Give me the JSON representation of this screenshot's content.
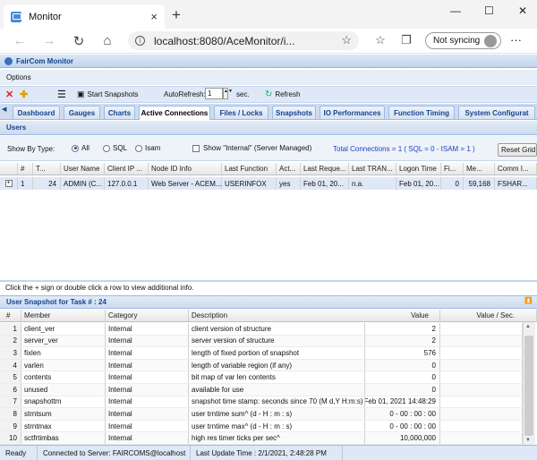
{
  "browser": {
    "tab_title": "Monitor",
    "new_tab": "+",
    "tab_close": "×",
    "address": "localhost:8080/AceMonitor/i...",
    "sync_label": "Not syncing",
    "min": "—",
    "max": "☐",
    "close": "✕"
  },
  "app": {
    "title": "FairCom Monitor",
    "options_label": "Options",
    "toolbar": {
      "start_snapshots": "Start Snapshots",
      "autorefresh_label": "AutoRefresh:",
      "autorefresh_value": "1",
      "sec_label": "sec.",
      "refresh": "Refresh"
    },
    "tabs": [
      "Dashboard",
      "Gauges",
      "Charts",
      "Active Connections",
      "Files / Locks",
      "Snapshots",
      "IO Performances",
      "Function Timing",
      "System Configurat"
    ],
    "active_tab": "Active Connections",
    "users_title": "Users",
    "filter": {
      "show_by_type": "Show By Type:",
      "options": [
        "All",
        "SQL",
        "Isam"
      ],
      "selected": "All",
      "show_internal": "Show \"Internal\" (Server Managed)",
      "total": "Total Connections = 1  ( SQL = 0 - ISAM = 1 )",
      "reset_grid": "Reset Grid"
    },
    "users_grid": {
      "headers": [
        "#",
        "T...",
        "User Name",
        "Client IP ...",
        "Node ID Info",
        "Last Function",
        "Act...",
        "Last Reque...",
        "Last TRAN...",
        "Logon Time",
        "Fi...",
        "Me...",
        "Comm I..."
      ],
      "rows": [
        [
          "1",
          "24",
          "ADMIN (C...",
          "127.0.0.1",
          "Web Server - ACEM...",
          "USERINFOX",
          "yes",
          "Feb 01, 20...",
          "n.a.",
          "Feb 01, 20...",
          "0",
          "59,168",
          "FSHAR..."
        ]
      ],
      "expander": "+"
    },
    "hint": "Click the + sign or double click a row to view additional info.",
    "snapshot": {
      "title": "User Snapshot for Task # : 24",
      "headers": [
        "#",
        "Member",
        "Category",
        "Description",
        "Value",
        "Value / Sec."
      ],
      "rows": [
        [
          "1",
          "client_ver",
          "Internal",
          "client version of structure",
          "2",
          ""
        ],
        [
          "2",
          "server_ver",
          "Internal",
          "server version of structure",
          "2",
          ""
        ],
        [
          "3",
          "fixlen",
          "Internal",
          "length of fixed portion of snapshot",
          "576",
          ""
        ],
        [
          "4",
          "varlen",
          "Internal",
          "length of variable region (if any)",
          "0",
          ""
        ],
        [
          "5",
          "contents",
          "Internal",
          "bit map of var len contents",
          "0",
          ""
        ],
        [
          "6",
          "unused",
          "Internal",
          "available for use",
          "0",
          ""
        ],
        [
          "7",
          "snapshottm",
          "Internal",
          "snapshot time stamp: seconds since 70 (M d,Y H:m:s)",
          "Feb 01, 2021 14:48:29",
          ""
        ],
        [
          "8",
          "strntsum",
          "Internal",
          "user trntime sum^ (d - H : m : s)",
          "0 - 00 : 00 : 00",
          ""
        ],
        [
          "9",
          "strntmax",
          "Internal",
          "user trntime max^ (d - H : m : s)",
          "0 - 00 : 00 : 00",
          ""
        ],
        [
          "10",
          "sctfrtimbas",
          "Internal",
          "high res timer ticks per sec^",
          "10,000,000",
          ""
        ]
      ]
    },
    "status": {
      "ready": "Ready",
      "connected": "Connected to Server: FAIRCOMS@localhost",
      "update": "Last Update Time : 2/1/2021, 2:48:28 PM"
    }
  }
}
